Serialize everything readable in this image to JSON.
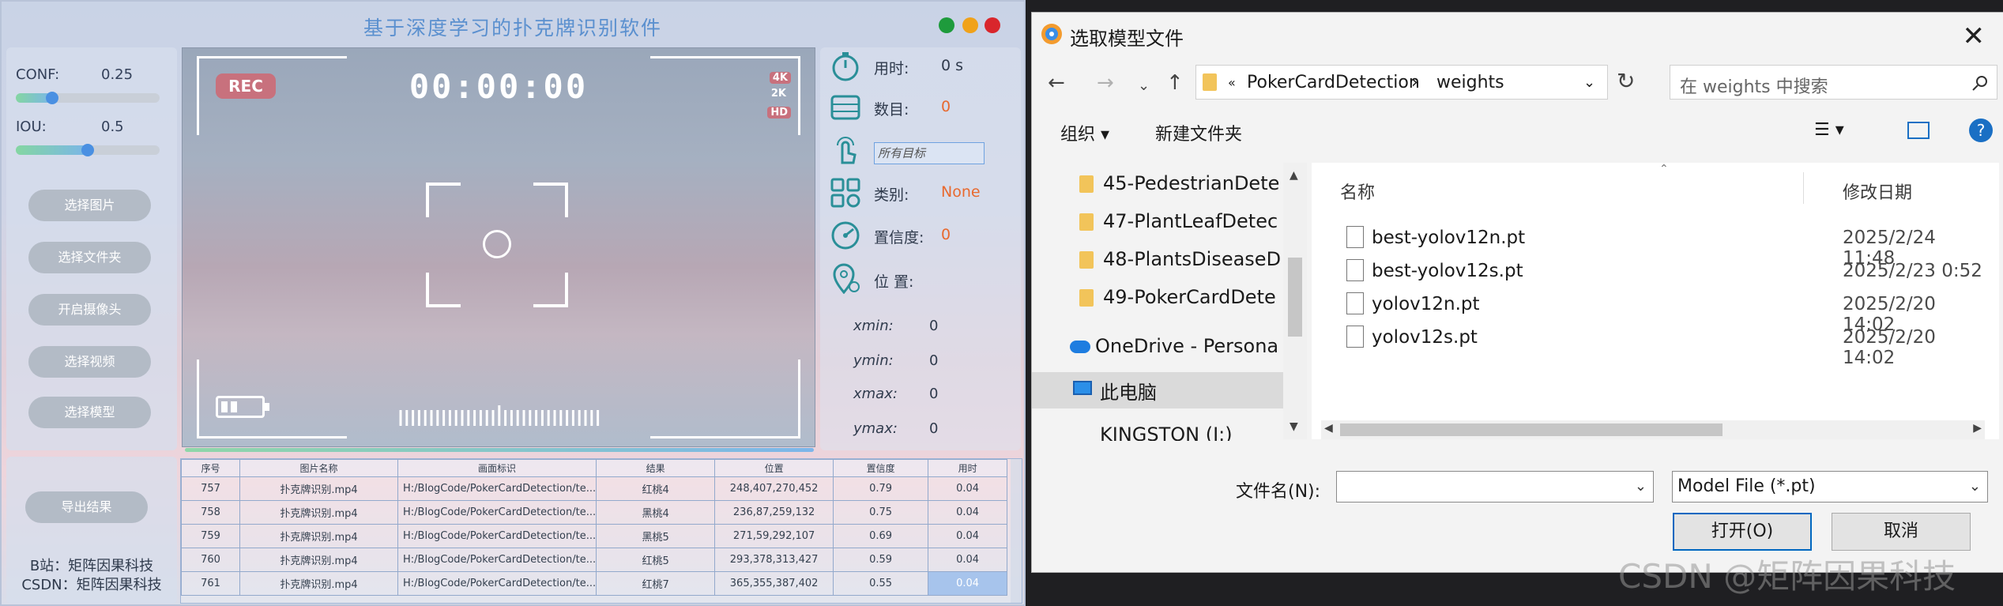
{
  "app": {
    "title": "基于深度学习的扑克牌识别软件",
    "conf_label": "CONF:",
    "conf_value": "0.25",
    "conf_fraction": 0.25,
    "iou_label": "IOU:",
    "iou_value": "0.5",
    "iou_fraction": 0.5,
    "buttons": [
      "选择图片",
      "选择文件夹",
      "开启摄像头",
      "选择视频",
      "选择模型"
    ],
    "export_button": "导出结果",
    "credits": [
      "B站：矩阵因果科技",
      "CSDN：矩阵因果科技"
    ],
    "video": {
      "rec": "REC",
      "timer": "00:00:00",
      "q4k": "4K",
      "q2k": "2K",
      "qhd": "HD"
    },
    "info": {
      "time_label": "用时:",
      "time_value": "0 s",
      "count_label": "数目:",
      "count_value": "0",
      "target_placeholder": "所有目标",
      "class_label": "类别:",
      "class_value": "None",
      "conf_label": "置信度:",
      "conf_value": "0",
      "pos_label": "位 置:",
      "coords": [
        {
          "label": "xmin:",
          "value": "0"
        },
        {
          "label": "ymin:",
          "value": "0"
        },
        {
          "label": "xmax:",
          "value": "0"
        },
        {
          "label": "ymax:",
          "value": "0"
        }
      ]
    },
    "table": {
      "headers": [
        "序号",
        "图片名称",
        "画面标识",
        "结果",
        "位置",
        "置信度",
        "用时"
      ],
      "rows": [
        [
          "757",
          "扑克牌识别.mp4",
          "H:/BlogCode/PokerCardDetection/te...",
          "红桃4",
          "248,407,270,452",
          "0.79",
          "0.04"
        ],
        [
          "758",
          "扑克牌识别.mp4",
          "H:/BlogCode/PokerCardDetection/te...",
          "黑桃4",
          "236,87,259,132",
          "0.75",
          "0.04"
        ],
        [
          "759",
          "扑克牌识别.mp4",
          "H:/BlogCode/PokerCardDetection/te...",
          "黑桃5",
          "271,59,292,107",
          "0.69",
          "0.04"
        ],
        [
          "760",
          "扑克牌识别.mp4",
          "H:/BlogCode/PokerCardDetection/te...",
          "红桃5",
          "293,378,313,427",
          "0.59",
          "0.04"
        ],
        [
          "761",
          "扑克牌识别.mp4",
          "H:/BlogCode/PokerCardDetection/te...",
          "红桃7",
          "365,355,387,402",
          "0.55",
          "0.04"
        ]
      ]
    },
    "colors": {
      "title": "#5b90cf",
      "accent_red": "#e8692e",
      "rec": "#c8717d"
    }
  },
  "dialog": {
    "title": "选取模型文件",
    "path": [
      "«",
      "PokerCardDetection",
      "›",
      "weights"
    ],
    "search_placeholder": "在 weights 中搜索",
    "toolbar_organize": "组织 ▾",
    "toolbar_newfolder": "新建文件夹",
    "nav_items": [
      "45-PedestrianDete",
      "47-PlantLeafDetec",
      "48-PlantsDiseaseD",
      "49-PokerCardDete",
      "OneDrive - Persona",
      "此电脑",
      "KINGSTON (I:)"
    ],
    "col_name": "名称",
    "col_date": "修改日期",
    "files": [
      {
        "name": "best-yolov12n.pt",
        "date": "2025/2/24 11:48"
      },
      {
        "name": "best-yolov12s.pt",
        "date": "2025/2/23 0:52"
      },
      {
        "name": "yolov12n.pt",
        "date": "2025/2/20 14:02"
      },
      {
        "name": "yolov12s.pt",
        "date": "2025/2/20 14:02"
      }
    ],
    "filename_label": "文件名(N):",
    "filename_value": "",
    "filter": "Model File (*.pt)",
    "open_button": "打开(O)",
    "cancel_button": "取消"
  },
  "watermark": "CSDN @矩阵因果科技"
}
